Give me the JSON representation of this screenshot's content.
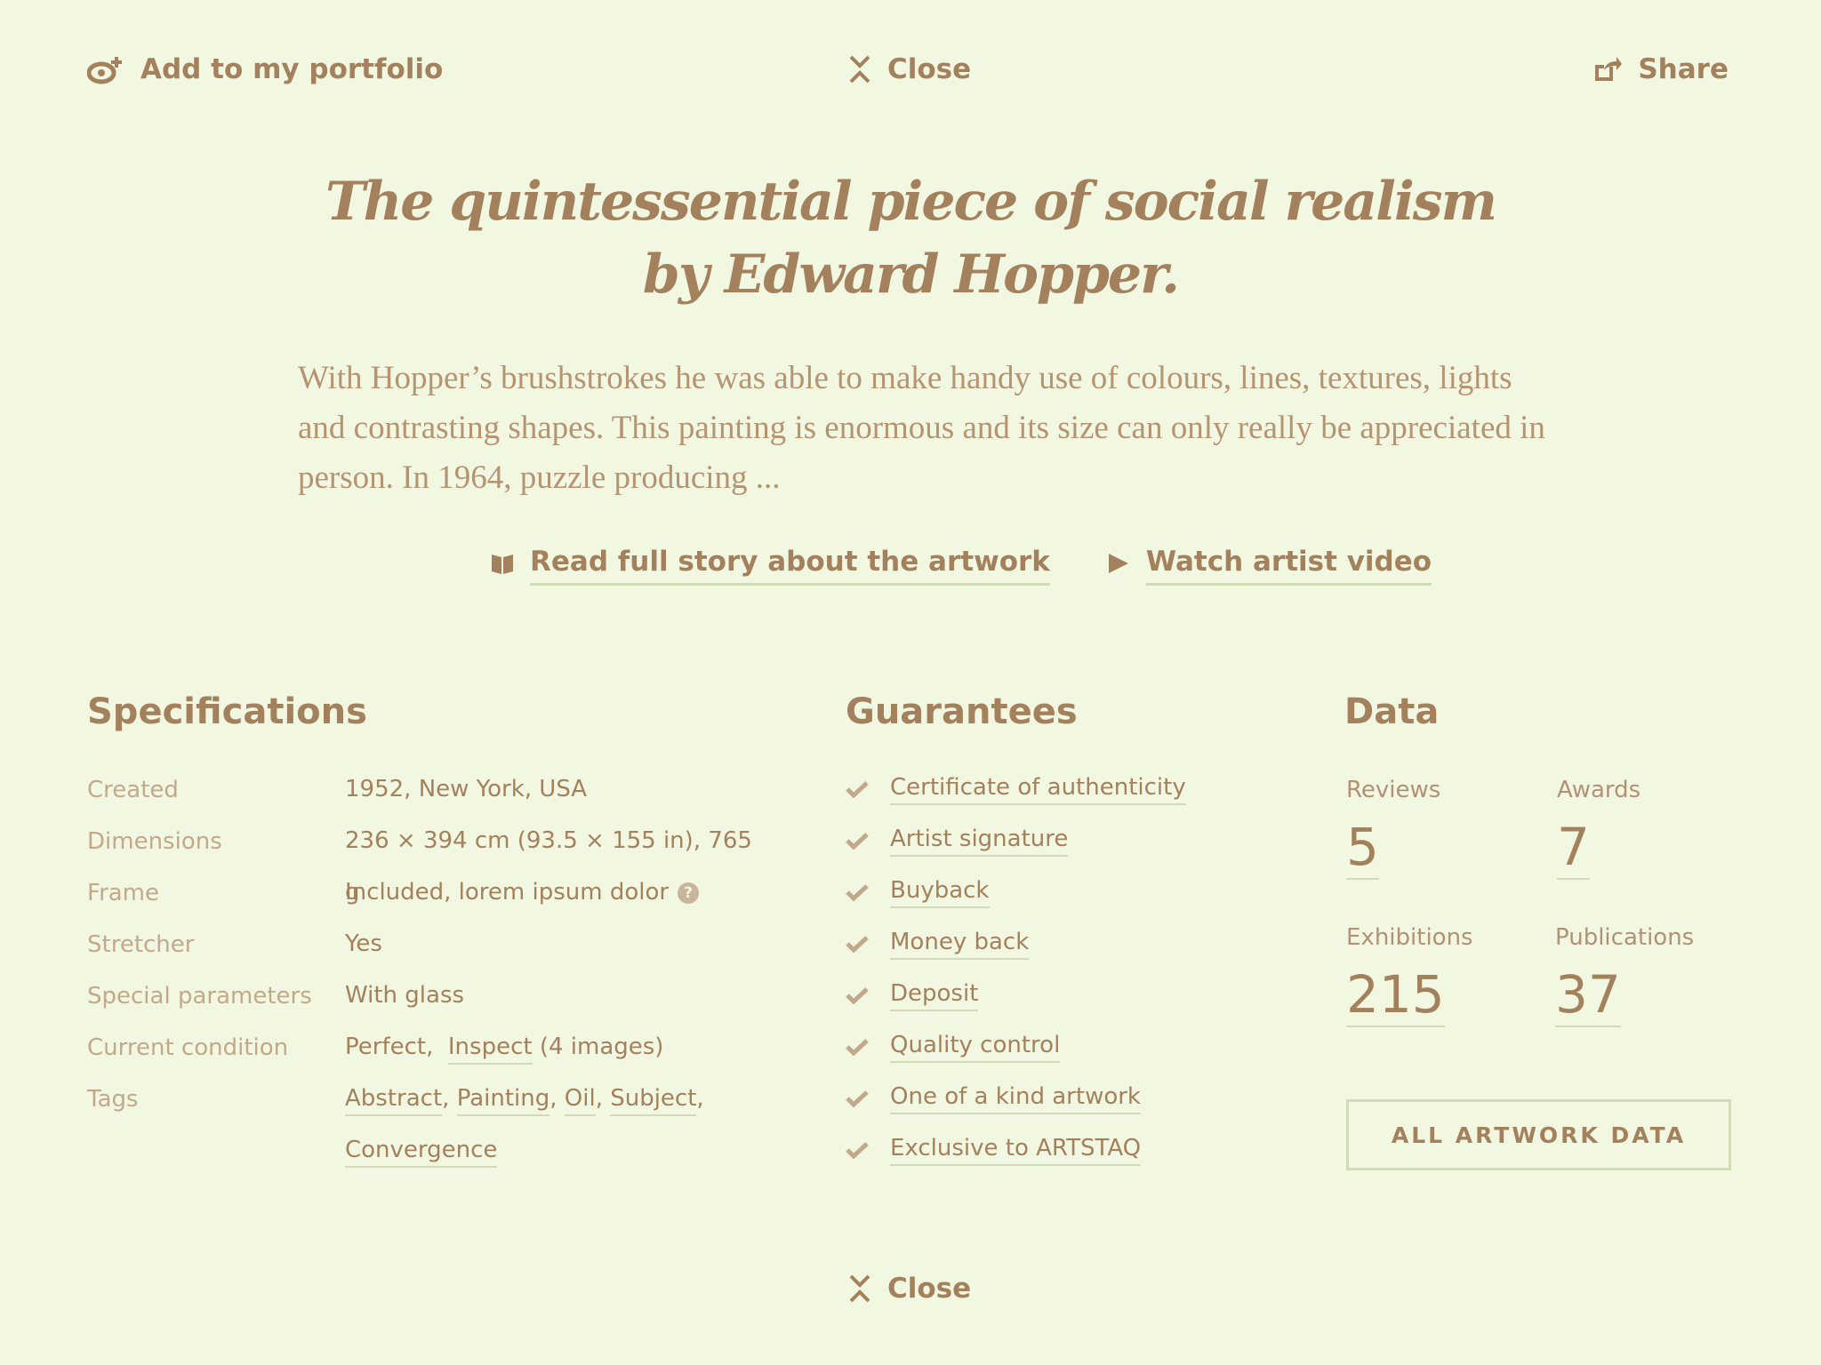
{
  "topbar": {
    "portfolio_label": "Add to my portfolio",
    "close_label": "Close",
    "share_label": "Share"
  },
  "headline": {
    "line1": "The quintessential piece of social realism",
    "line2": "by Edward Hopper."
  },
  "story": {
    "text": "With Hopper’s brushstrokes he was able to make handy use of colours, lines, textures, lights and contrasting shapes. This painting is enormous and its size can only really be appreciated in person. In 1964, puzzle producing ...",
    "read_link": "Read full story about the artwork",
    "video_link": "Watch artist video"
  },
  "specifications": {
    "title": "Specifications",
    "rows": [
      {
        "label": "Created",
        "value": "1952, New York, USA"
      },
      {
        "label": "Dimensions",
        "value": "236 × 394 cm (93.5 × 155 in), 765 g"
      },
      {
        "label": "Frame",
        "value": "Included, lorem ipsum dolor",
        "help_icon": "?"
      },
      {
        "label": "Stretcher",
        "value": "Yes"
      },
      {
        "label": "Special parameters",
        "value": "With glass"
      },
      {
        "label": "Current condition",
        "value": "Perfect,",
        "link": "Inspect",
        "suffix": "(4 images)"
      },
      {
        "label": "Tags",
        "tags": [
          "Abstract",
          "Painting",
          "Oil",
          "Subject",
          "Convergence"
        ]
      }
    ]
  },
  "guarantees": {
    "title": "Guarantees",
    "items": [
      "Certificate of authenticity",
      "Artist signature",
      "Buyback",
      "Money back",
      "Deposit",
      "Quality control",
      "One of a kind artwork",
      "Exclusive to ARTSTAQ"
    ]
  },
  "data": {
    "title": "Data",
    "stats": {
      "reviews": {
        "label": "Reviews",
        "value": "5"
      },
      "awards": {
        "label": "Awards",
        "value": "7"
      },
      "exhibitions": {
        "label": "Exhibitions",
        "value": "215"
      },
      "publications": {
        "label": "Publications",
        "value": "37"
      }
    },
    "all_button": "All artwork data"
  },
  "bottom": {
    "close_label": "Close"
  },
  "icons": {
    "portfolio": "add-to-portfolio-icon",
    "close": "collapse-close-icon",
    "share": "share-icon",
    "book": "book-icon",
    "play": "play-icon",
    "check": "check-icon",
    "help": "question-icon"
  },
  "colors": {
    "background": "#f1f7e1",
    "text": "#a4815d",
    "muted": "#c2a98b",
    "underline": "#cfdcb5"
  }
}
